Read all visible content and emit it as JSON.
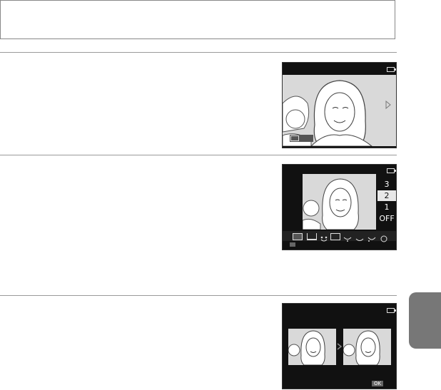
{
  "header_box": {
    "text": ""
  },
  "panels": [
    {
      "id": "playback",
      "ok_label": "",
      "icons": [
        "battery-icon",
        "next-arrow-icon"
      ]
    },
    {
      "id": "glamour-retouch",
      "levels": [
        "3",
        "2",
        "1",
        "OFF"
      ],
      "selected_level": "2",
      "effect_icons": [
        "all-icon",
        "face-icon",
        "smile-icon",
        "eyes-icon",
        "cheek-icon",
        "mouth-icon",
        "skin-icon",
        "glow-icon"
      ]
    },
    {
      "id": "compare",
      "ok_label": "OK",
      "icons": [
        "battery-icon",
        "compare-arrow-icon"
      ]
    }
  ],
  "colors": {
    "tab": "#777777",
    "screen_bg": "#111111",
    "photo_bg": "#d9d9d9"
  }
}
